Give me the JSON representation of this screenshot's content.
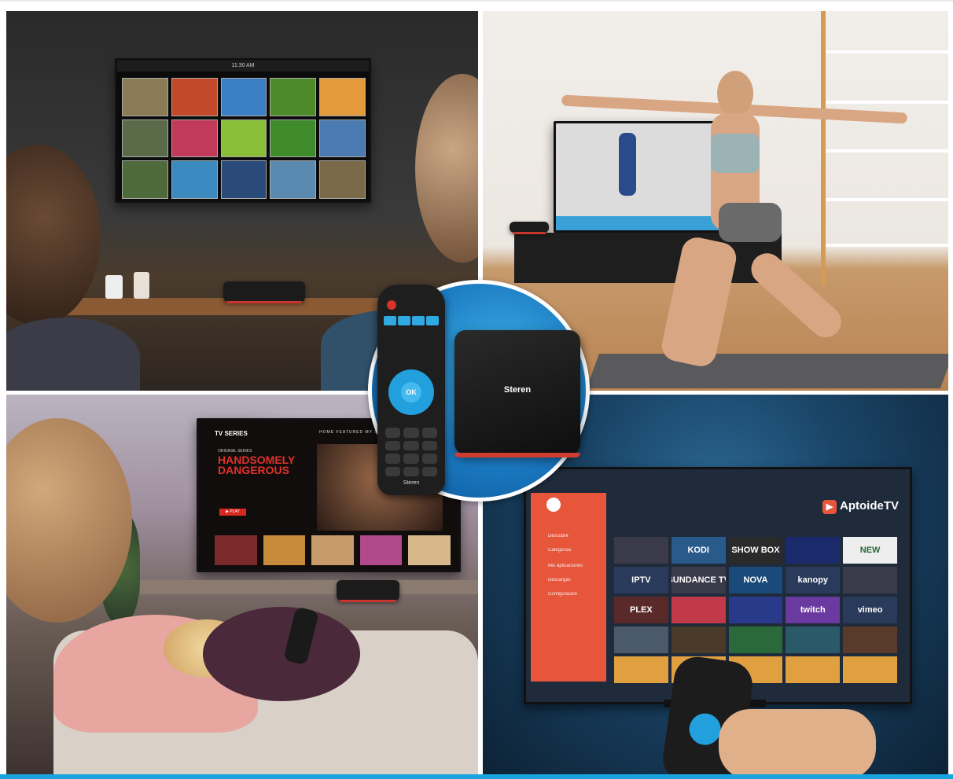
{
  "gallery_tv": {
    "clock": "11:30 AM",
    "tiles": [
      "#8a7a55",
      "#c24a2a",
      "#3b7fc4",
      "#4e8a2a",
      "#e39a3a",
      "#5b6b4a",
      "#c23a5a",
      "#8abf3a",
      "#3f8a2a",
      "#4a7ab0",
      "#4f6a3a",
      "#3a8ac0",
      "#2a4a7a",
      "#5a8ab0",
      "#7a6a4a"
    ]
  },
  "series_tv": {
    "title": "TV SERIES",
    "nav": "HOME  FEATURED  MY SHOWS  MY MOVIES  SEARCH",
    "original": "ORIGINAL SERIES",
    "show_line1": "HANDSOMELY",
    "show_line2": "DANGEROUS",
    "play_label": "▶ PLAY",
    "thumbs": [
      "#7a2a2a",
      "#c78a3a",
      "#c79a6a",
      "#b04a8a",
      "#d8b88a"
    ]
  },
  "aptoide_tv": {
    "logo": "AptoideTV",
    "logo_mark": "▶",
    "menu": [
      "Descubre",
      "Categorías",
      "Mis aplicaciones",
      "Descargas",
      "Configuración"
    ],
    "tiles": [
      "",
      "KODI",
      "SHOW BOX",
      "",
      "NEW",
      "IPTV",
      "SUNDANCE TV",
      "NOVA",
      "kanopy",
      "",
      "PLEX",
      "",
      "",
      "twitch",
      "vimeo",
      "",
      "",
      "",
      "",
      "",
      "",
      "",
      "",
      "",
      ""
    ],
    "tile_colors": [
      "#3a3a4a",
      "#2a5a8a",
      "#2a2a2a",
      "#1a2a6a",
      "#eeeeee",
      "#2a3a5a",
      "#3a3a4a",
      "#1a4a7a",
      "#2a3a5a",
      "#3a3a4a",
      "#5a2a2a",
      "#c23a4a",
      "#2a3a8a",
      "#6a3aa0",
      "#2a3a5a",
      "#4a5a6a",
      "#4a3a2a",
      "#2a6a3a",
      "#2a5a6a",
      "#5a3a2a",
      "#e0a040",
      "#e0a040",
      "#e0a040",
      "#e0a040",
      "#e0a040"
    ]
  },
  "remote": {
    "ok_label": "OK",
    "brand": "Steren"
  },
  "box": {
    "brand": "Steren"
  }
}
